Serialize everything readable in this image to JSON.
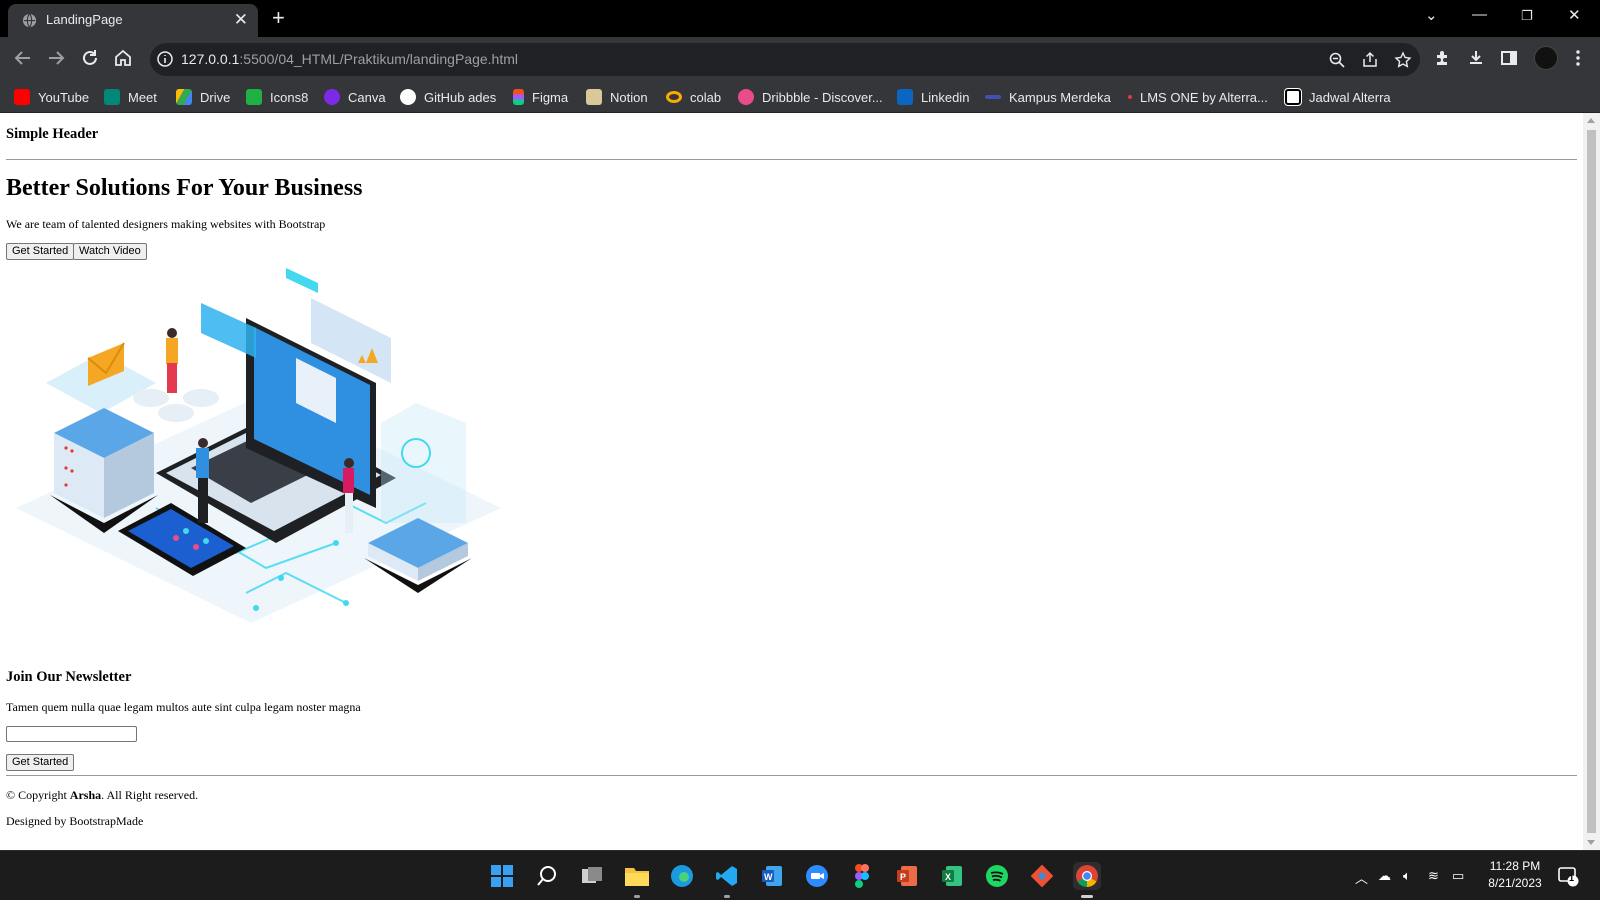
{
  "browser": {
    "tab_title": "LandingPage",
    "url_host": "127.0.0.1",
    "url_rest": ":5500/04_HTML/Praktikum/landingPage.html",
    "bookmarks": [
      {
        "label": "YouTube",
        "icon": "youtube-icon",
        "color": "#ff0000"
      },
      {
        "label": "Meet",
        "icon": "meet-icon",
        "color": "#00897b"
      },
      {
        "label": "Drive",
        "icon": "drive-icon",
        "color": "#fbbc04"
      },
      {
        "label": "Icons8",
        "icon": "icons8-icon",
        "color": "#1fb141"
      },
      {
        "label": "Canva",
        "icon": "canva-icon",
        "color": "#7d2ae8"
      },
      {
        "label": "GitHub ades",
        "icon": "github-icon",
        "color": "#ffffff"
      },
      {
        "label": "Figma",
        "icon": "figma-icon",
        "color": "#f24e1e"
      },
      {
        "label": "Notion",
        "icon": "notion-icon",
        "color": "#d9c89a"
      },
      {
        "label": "colab",
        "icon": "colab-icon",
        "color": "#f9ab00"
      },
      {
        "label": "Dribbble - Discover...",
        "icon": "dribbble-icon",
        "color": "#ea4c89"
      },
      {
        "label": "Linkedin",
        "icon": "linkedin-icon",
        "color": "#0a66c2"
      },
      {
        "label": "Kampus Merdeka",
        "icon": "kampus-merdeka-icon",
        "color": "#3f51b5"
      },
      {
        "label": "LMS ONE by Alterra...",
        "icon": "lms-icon",
        "color": "#e53935"
      },
      {
        "label": "Jadwal Alterra",
        "icon": "notion-icon",
        "color": "#ffffff"
      }
    ]
  },
  "page": {
    "header": "Simple Header",
    "hero": {
      "title": "Better Solutions For Your Business",
      "text": "We are team of talented designers making websites with Bootstrap",
      "primary_button": "Get Started",
      "secondary_button": "Watch Video"
    },
    "newsletter": {
      "title": "Join Our Newsletter",
      "text": "Tamen quem nulla quae legam multos aute sint culpa legam noster magna",
      "input_value": "",
      "button": "Get Started"
    },
    "footer": {
      "copyright_prefix": "© Copyright ",
      "brand": "Arsha",
      "copyright_suffix": ". All Right reserved.",
      "designed_by": "Designed by BootstrapMade"
    }
  },
  "taskbar": {
    "time": "11:28 PM",
    "date": "8/21/2023",
    "notification_count": "1"
  }
}
